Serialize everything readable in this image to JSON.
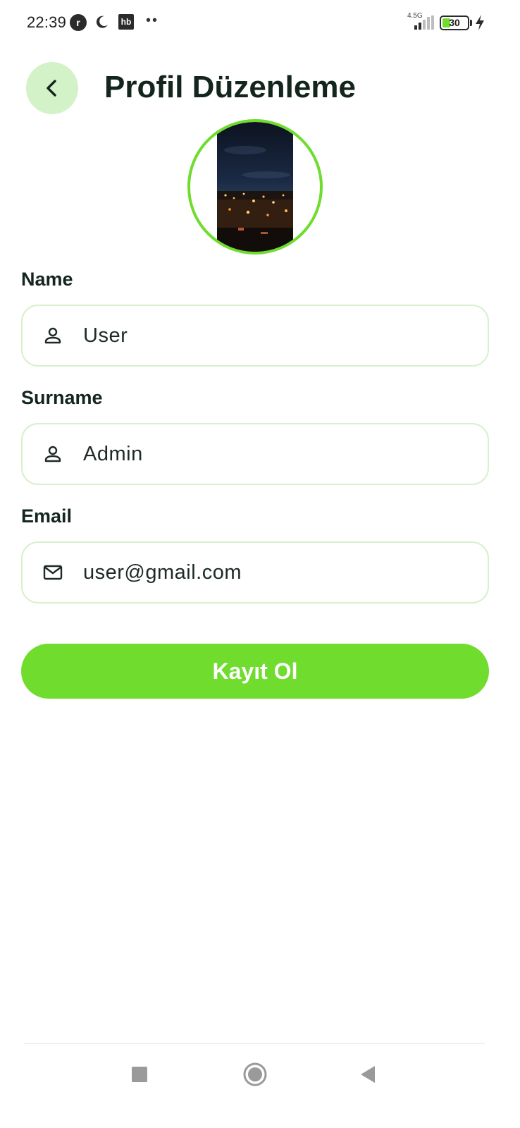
{
  "status_bar": {
    "time": "22:39",
    "indicators": [
      "r-badge-icon",
      "moon-icon",
      "hb-icon",
      "more-dots-icon"
    ],
    "hb_label": "hb",
    "r_label": "r",
    "dots": "••",
    "network_type": "4.5G",
    "battery_level": "30"
  },
  "header": {
    "back_icon": "chevron-left-icon",
    "title": "Profil Düzenleme"
  },
  "profile": {
    "avatar_description": "city-night-photo"
  },
  "form": {
    "name": {
      "label": "Name",
      "value": "User",
      "icon": "person-icon"
    },
    "surname": {
      "label": "Surname",
      "value": "Admin",
      "icon": "person-icon"
    },
    "email": {
      "label": "Email",
      "value": "user@gmail.com",
      "icon": "mail-icon"
    },
    "submit_label": "Kayıt Ol"
  },
  "navigation": {
    "buttons": [
      "recents-icon",
      "home-icon",
      "back-triangle-icon"
    ]
  },
  "colors": {
    "accent": "#6fdc2e",
    "back_button_bg": "#d3f2c8",
    "input_border": "#d8f0cc",
    "text_dark": "#14251d"
  }
}
